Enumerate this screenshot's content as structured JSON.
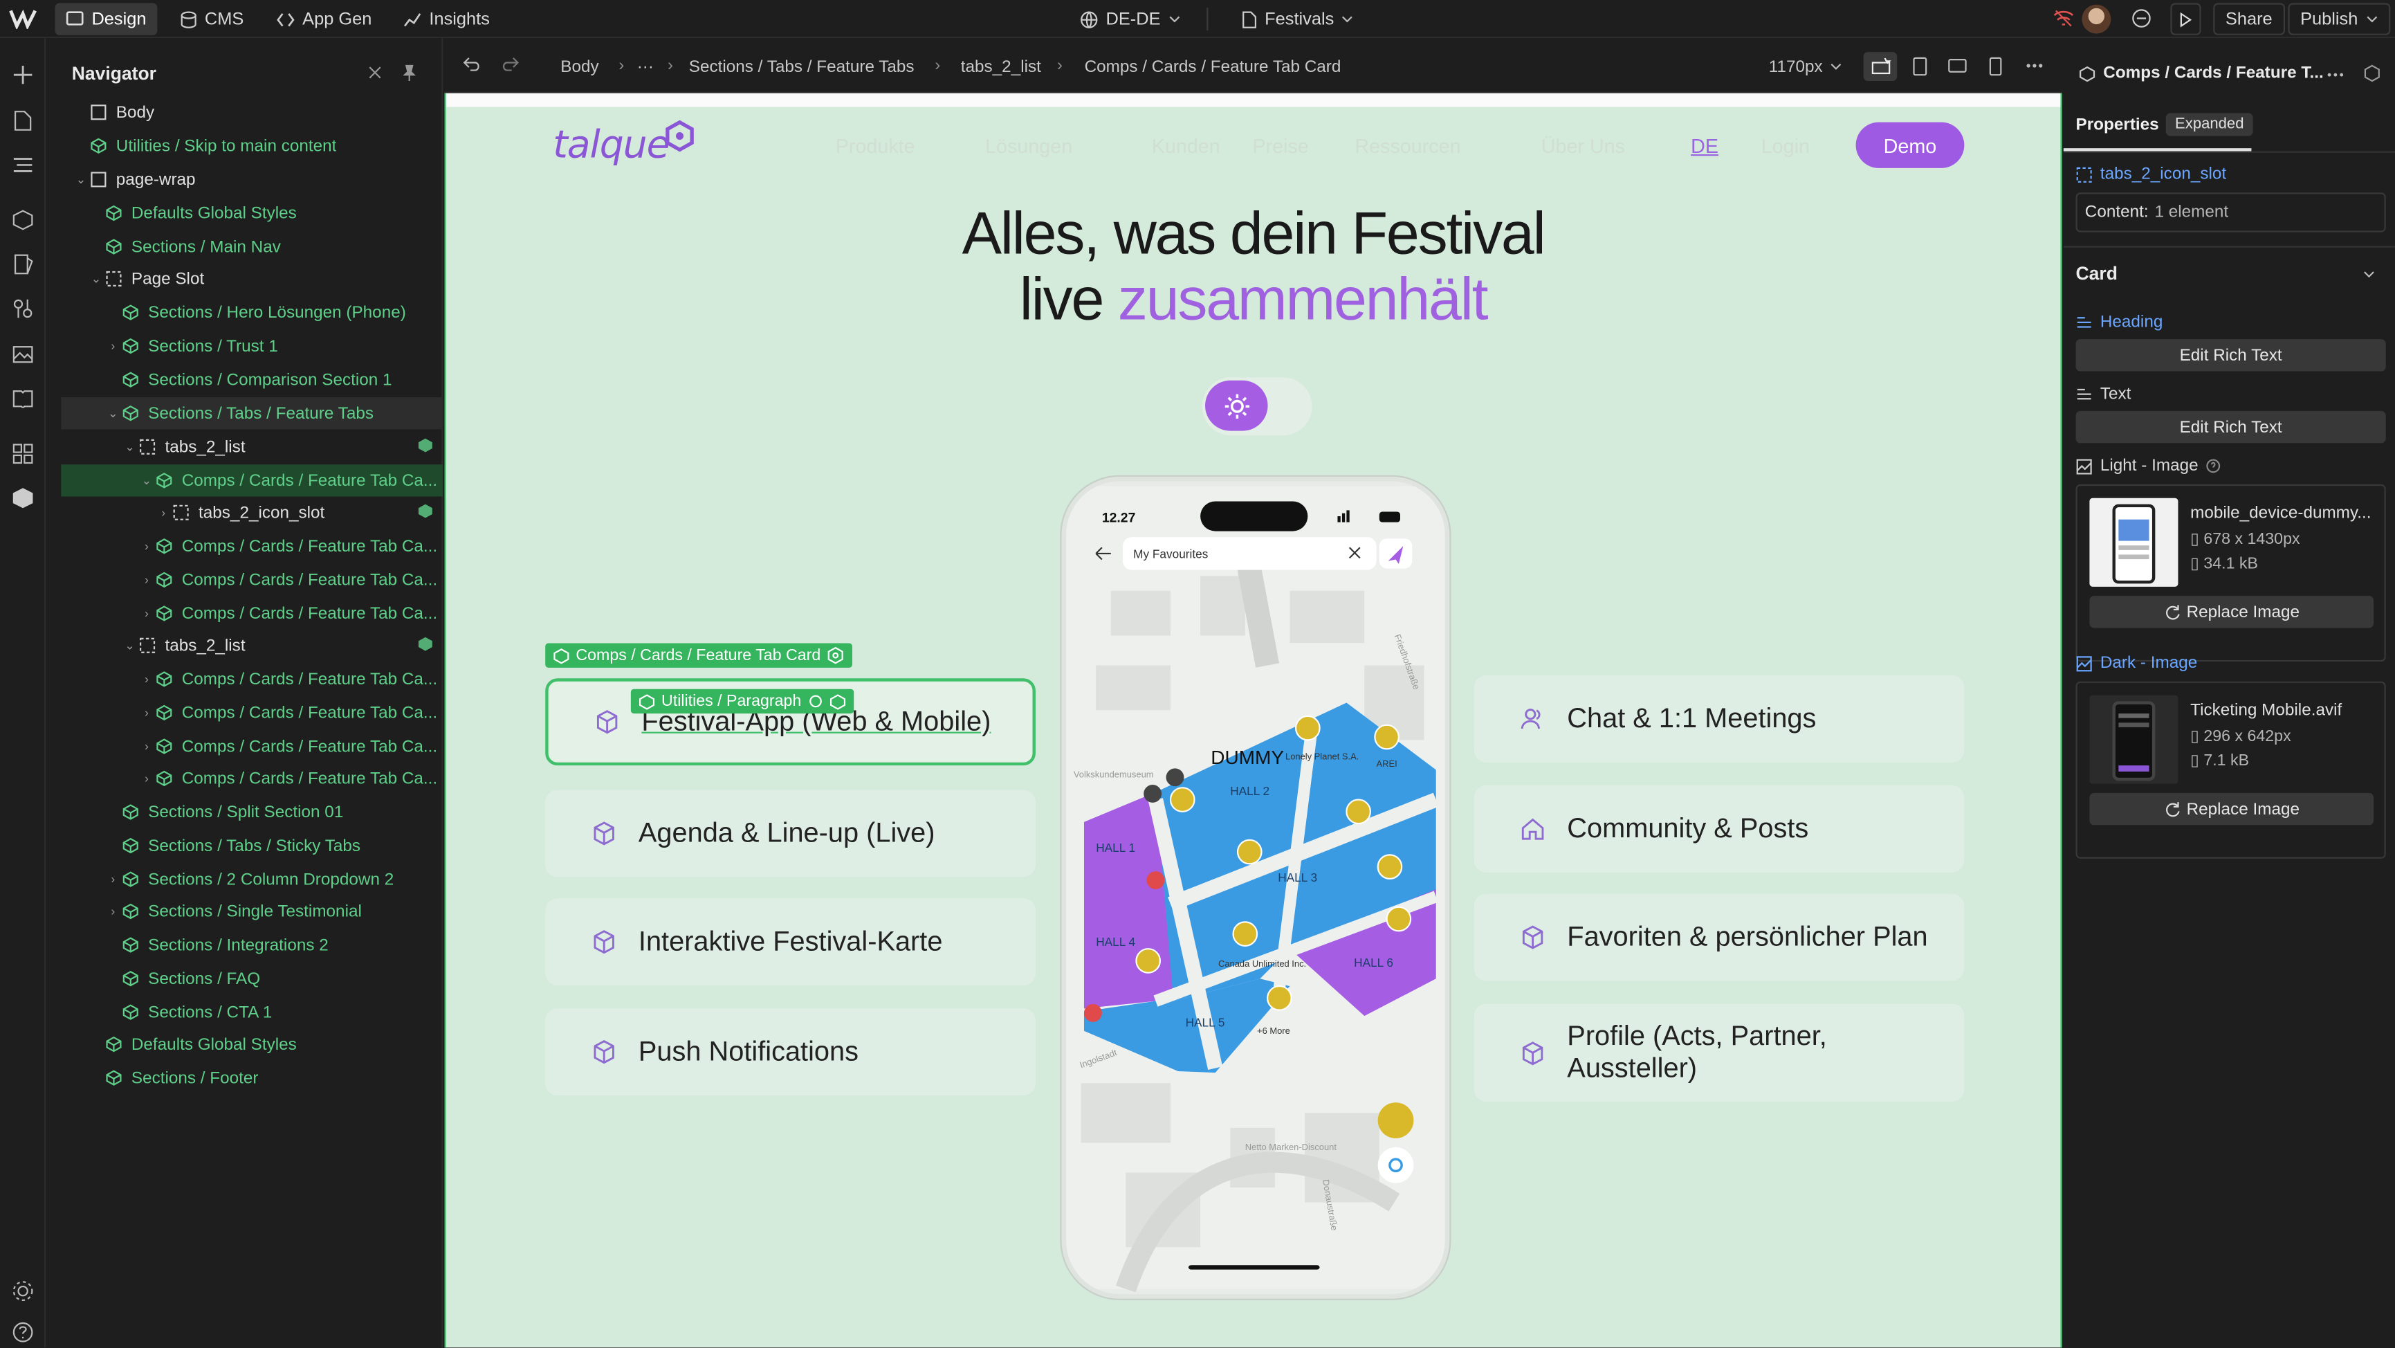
{
  "topbar": {
    "tabs": [
      {
        "label": "Design",
        "icon": "design-icon"
      },
      {
        "label": "CMS",
        "icon": "database-icon"
      },
      {
        "label": "App Gen",
        "icon": "code-icon"
      },
      {
        "label": "Insights",
        "icon": "chart-icon"
      }
    ],
    "locale": "DE-DE",
    "page": "Festivals",
    "share_label": "Share",
    "publish_label": "Publish"
  },
  "navigator": {
    "title": "Navigator",
    "rows": [
      {
        "label": "Body",
        "kind": "box"
      },
      {
        "label": "Utilities / Skip to main content",
        "kind": "comp"
      },
      {
        "label": "page-wrap",
        "kind": "box"
      },
      {
        "label": "Defaults Global Styles",
        "kind": "comp"
      },
      {
        "label": "Sections / Main Nav",
        "kind": "comp"
      },
      {
        "label": "Page Slot",
        "kind": "slot"
      },
      {
        "label": "Sections / Hero Lösungen (Phone)",
        "kind": "comp"
      },
      {
        "label": "Sections / Trust 1",
        "kind": "comp"
      },
      {
        "label": "Sections / Comparison Section 1",
        "kind": "comp"
      },
      {
        "label": "Sections / Tabs / Feature Tabs",
        "kind": "comp"
      },
      {
        "label": "tabs_2_list",
        "kind": "slot"
      },
      {
        "label": "Comps / Cards / Feature Tab Ca...",
        "kind": "comp"
      },
      {
        "label": "tabs_2_icon_slot",
        "kind": "slot"
      },
      {
        "label": "Comps / Cards / Feature Tab Ca...",
        "kind": "comp"
      },
      {
        "label": "Comps / Cards / Feature Tab Ca...",
        "kind": "comp"
      },
      {
        "label": "Comps / Cards / Feature Tab Ca...",
        "kind": "comp"
      },
      {
        "label": "tabs_2_list",
        "kind": "slot"
      },
      {
        "label": "Comps / Cards / Feature Tab Ca...",
        "kind": "comp"
      },
      {
        "label": "Comps / Cards / Feature Tab Ca...",
        "kind": "comp"
      },
      {
        "label": "Comps / Cards / Feature Tab Ca...",
        "kind": "comp"
      },
      {
        "label": "Comps / Cards / Feature Tab Ca...",
        "kind": "comp"
      },
      {
        "label": "Sections / Split Section 01",
        "kind": "comp"
      },
      {
        "label": "Sections / Tabs / Sticky Tabs",
        "kind": "comp"
      },
      {
        "label": "Sections / 2 Column Dropdown 2",
        "kind": "comp"
      },
      {
        "label": "Sections / Single Testimonial",
        "kind": "comp"
      },
      {
        "label": "Sections / Integrations 2",
        "kind": "comp"
      },
      {
        "label": "Sections / FAQ",
        "kind": "comp"
      },
      {
        "label": "Sections / CTA 1",
        "kind": "comp"
      },
      {
        "label": "Defaults Global Styles",
        "kind": "comp"
      },
      {
        "label": "Sections / Footer",
        "kind": "comp"
      }
    ]
  },
  "breadcrumb": {
    "items": [
      "Body",
      "···",
      "Sections / Tabs / Feature Tabs",
      "tabs_2_list",
      "Comps / Cards / Feature Tab Card"
    ],
    "width_label": "1170px"
  },
  "site": {
    "logo": "talque",
    "nav_links": [
      "Produkte",
      "Lösungen",
      "Kunden",
      "Preise",
      "Ressourcen",
      "Über Uns",
      "Login"
    ],
    "lang": "DE",
    "demo_label": "Demo",
    "hero_line1": "Alles, was dein Festival",
    "hero_line2_plain": "live ",
    "hero_line2_accent": "zusammenhält",
    "left_cards": [
      "Festival-App (Web & Mobile)",
      "Agenda & Line-up (Live)",
      "Interaktive Festival-Karte",
      "Push Notifications"
    ],
    "right_cards": [
      "Chat & 1:1 Meetings",
      "Community & Posts",
      "Favoriten & persönlicher Plan",
      "Profile (Acts, Partner, Aussteller)"
    ],
    "selection_tag": "Comps / Cards / Feature Tab Card",
    "paragraph_tag": "Utilities / Paragraph"
  },
  "phone": {
    "time": "12.27",
    "search_text": "My Favourites",
    "map_brand": "DUMMY",
    "halls": [
      "HALL 1",
      "HALL 2",
      "HALL 3",
      "HALL 4",
      "HALL 5",
      "HALL 6"
    ],
    "map_labels": [
      "Lonely Planet S.A.",
      "AREI",
      "Canada Unlimited Inc.",
      "+6 More",
      "Volkskundemuseum",
      "Friedhofstraße",
      "Ingolstadt",
      "Netto Marken-Discount",
      "Donaustraße"
    ]
  },
  "rightpanel": {
    "header": "Comps / Cards / Feature T...",
    "tab_properties": "Properties",
    "tab_expanded": "Expanded",
    "slot_name": "tabs_2_icon_slot",
    "content_label": "Content:",
    "content_value": "1 element",
    "card_title": "Card",
    "heading_label": "Heading",
    "edit_rich_text": "Edit Rich Text",
    "text_label": "Text",
    "edit_rich_text_2": "Edit Rich Text",
    "light_image_label": "Light - Image",
    "light_image": {
      "name": "mobile_device-dummy...",
      "dims": "678 x 1430px",
      "size": "34.1 kB"
    },
    "replace_label": "Replace Image",
    "dark_image_label": "Dark - Image",
    "dark_image": {
      "name": "Ticketing Mobile.avif",
      "dims": "296 x 642px",
      "size": "7.1 kB"
    },
    "replace_label_2": "Replace Image"
  },
  "colors": {
    "accent": "#a061e0",
    "selection": "#34b55e",
    "canvas_bg": "#d4eadb"
  }
}
